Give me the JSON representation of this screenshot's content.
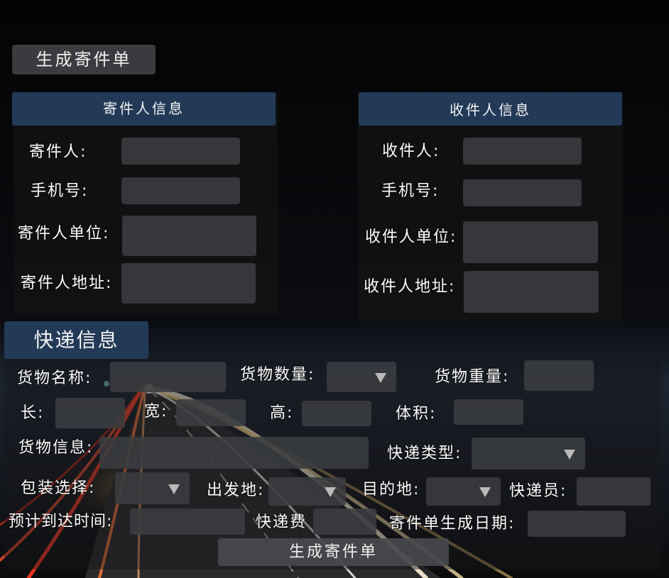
{
  "header": {
    "generate_button": "生成寄件单"
  },
  "sender": {
    "title": "寄件人信息",
    "name_label": "寄件人:",
    "phone_label": "手机号:",
    "company_label": "寄件人单位:",
    "address_label": "寄件人地址:"
  },
  "receiver": {
    "title": "收件人信息",
    "name_label": "收件人:",
    "phone_label": "手机号:",
    "company_label": "收件人单位:",
    "address_label": "收件人地址:"
  },
  "express": {
    "title": "快递信息",
    "goods_name_label": "货物名称:",
    "goods_qty_label": "货物数量:",
    "goods_weight_label": "货物重量:",
    "length_label": "长:",
    "width_label": "宽:",
    "height_label": "高:",
    "volume_label": "体积:",
    "goods_info_label": "货物信息:",
    "express_type_label": "快递类型:",
    "packaging_label": "包装选择:",
    "origin_label": "出发地:",
    "destination_label": "目的地:",
    "courier_label": "快递员:",
    "eta_label": "预计到达时间:",
    "fee_label": "快递费",
    "date_label": "寄件单生成日期:",
    "submit_button": "生成寄件单"
  }
}
